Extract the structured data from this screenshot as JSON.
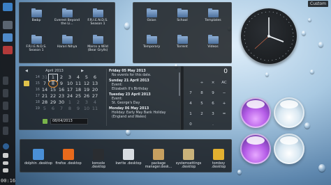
{
  "topbar": {
    "custom_label": "Custom"
  },
  "left_panel": {
    "clock": "00:16"
  },
  "folder_view_1": {
    "items": [
      {
        "label": "Bwbp"
      },
      {
        "label": "Everest Beyond the Li..."
      },
      {
        "label": "F.R.I.E.N.D.S. Season 1"
      },
      {
        "label": "F.R.I.E.N.D.S. Season 1"
      },
      {
        "label": "Harari Nihya"
      },
      {
        "label": "Marco a Wild (Bear Grylls)"
      }
    ]
  },
  "folder_view_2": {
    "items": [
      {
        "label": "Ozian"
      },
      {
        "label": "School"
      },
      {
        "label": "Templates"
      },
      {
        "label": "Temporary"
      },
      {
        "label": "Torrent"
      },
      {
        "label": "Videos"
      }
    ]
  },
  "calendar": {
    "month": "April",
    "year": "2013",
    "weeks": [
      "14",
      "15",
      "16",
      "17",
      "18",
      "19"
    ],
    "days": [
      "31",
      "1",
      "2",
      "3",
      "4",
      "5",
      "6",
      "7",
      "8",
      "9",
      "10",
      "11",
      "12",
      "13",
      "14",
      "15",
      "16",
      "17",
      "18",
      "19",
      "20",
      "21",
      "22",
      "23",
      "24",
      "25",
      "26",
      "27",
      "28",
      "29",
      "30",
      "1",
      "2",
      "3",
      "4",
      "5",
      "6",
      "7",
      "8",
      "9",
      "10",
      "11"
    ],
    "date_input": "08/04/2013",
    "events": [
      {
        "date": "Friday 05 May 2013",
        "lines": [
          "No events for this date."
        ]
      },
      {
        "date": "Sunday 21 April 2013",
        "lines": [
          "Event:",
          "Elizabeth II's Birthday"
        ]
      },
      {
        "date": "Tuesday 23 April 2013",
        "lines": [
          "Event:",
          "St. George's Day"
        ]
      },
      {
        "date": "Monday 06 May 2013",
        "lines": [
          "Holiday: Early May Bank Holiday (England and Wales)"
        ]
      }
    ]
  },
  "calculator": {
    "display": "0",
    "keys": [
      "",
      "÷",
      "×",
      "AC",
      "7",
      "8",
      "9",
      "−",
      "4",
      "5",
      "6",
      "+",
      "1",
      "2",
      "3",
      "=",
      "0",
      "",
      ".",
      ""
    ]
  },
  "launcher": {
    "apps": [
      {
        "label": "dolphin .desktop",
        "icon": "dolphin-icon",
        "color": "#4a8fd6"
      },
      {
        "label": "firefox .desktop",
        "icon": "firefox-icon",
        "color": "#e86a1c"
      },
      {
        "label": "konsole .desktop",
        "icon": "konsole-icon",
        "color": "#2a2d31"
      },
      {
        "label": "kwrite .desktop",
        "icon": "kwrite-icon",
        "color": "#d8dde2"
      },
      {
        "label": "package manager.desk...",
        "icon": "package-manager-icon",
        "color": "#c7a060"
      },
      {
        "label": "systemsettings .desktop",
        "icon": "system-settings-icon",
        "color": "#c9b27a"
      },
      {
        "label": "tomboy .desktop",
        "icon": "tomboy-icon",
        "color": "#e2b030"
      }
    ]
  }
}
